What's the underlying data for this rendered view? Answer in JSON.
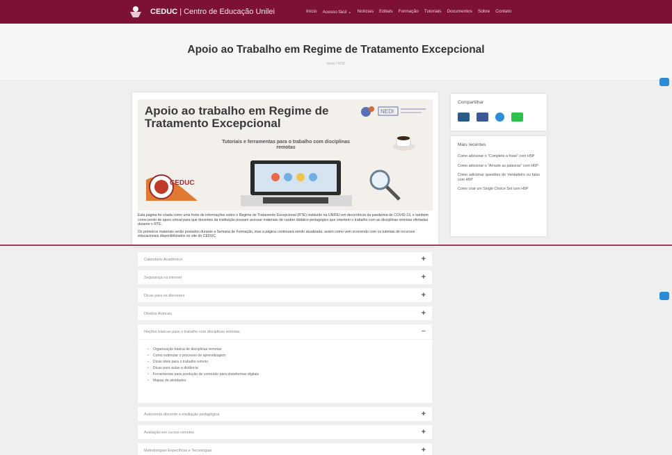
{
  "header": {
    "brand_short": "CEDUC",
    "brand_full": "| Centro de Educação Unilei",
    "nav": [
      {
        "label": "Início"
      },
      {
        "label": "Acesso fácil ⌄"
      },
      {
        "label": "Notícias"
      },
      {
        "label": "Editais"
      },
      {
        "label": "Formação"
      },
      {
        "label": "Tutoriais"
      },
      {
        "label": "Documentos"
      },
      {
        "label": "Sobre"
      },
      {
        "label": "Contato"
      }
    ]
  },
  "page": {
    "title": "Apoio ao Trabalho em Regime de Tratamento Excepcional",
    "breadcrumb": "Início / RTE"
  },
  "banner": {
    "title": "Apoio ao trabalho em Regime de Tratamento Excepcional",
    "subtitle": "Tutoriais e ferramentas para o trabalho com disciplinas remotas",
    "nedi_label": "NEDI",
    "ceduc_label": "CEDUC"
  },
  "intro": {
    "p1": "Esta página foi criada como uma fonte de informações sobre o Regime de Tratamento Excepcional (RTE) instituído na UNIFEI em decorrência da pandemia de COVID-19, e também como ponto de apoio virtual para que docentes da instituição possam acessar materiais de caráter didático-pedagógico que orientem o trabalho com as disciplinas remotas ofertadas durante o RTE.",
    "p2": "Os primeiros materiais serão postados durante a Semana de Formação, mas a página continuará sendo atualizada, assim como vem ocorrendo com os tutoriais de recursos educacionais disponibilizados no site do CEDUC."
  },
  "share": {
    "heading": "Compartilhar",
    "icons": [
      {
        "name": "email-icon",
        "color": "#2c5b8a"
      },
      {
        "name": "facebook-icon",
        "color": "#3b5998"
      },
      {
        "name": "telegram-icon",
        "color": "#2a8fd4"
      },
      {
        "name": "whatsapp-icon",
        "color": "#2ec24a"
      }
    ]
  },
  "recent": {
    "heading": "Mais recentes",
    "items": [
      "Como adicionar o \"Complete a frase\" com H5P",
      "Como adicionar o \"Arraste as palavras\" com H5P",
      "Como adicionar questões de Verdadeiro ou falso com H5P",
      "Como criar um Single Choice Set com H5P"
    ]
  },
  "accordion": {
    "before": [
      {
        "label": "Calendário Acadêmico",
        "sign": "+"
      },
      {
        "label": "Segurança na internet",
        "sign": "+"
      },
      {
        "label": "Dicas para os discentes",
        "sign": "+"
      },
      {
        "label": "Direitos Autorais",
        "sign": "+"
      }
    ],
    "open": {
      "label": "Noções básicas para o trabalho com disciplinas remotas",
      "sign": "−",
      "items": [
        "Organização básica de disciplinas remotas",
        "Como estimular o processo de aprendizagem",
        "Dicas úteis para o trabalho remoto",
        "Dicas para aulas a distância",
        "Ferramentas para produção de conteúdo para plataformas digitais",
        "Mapas de atividades"
      ]
    },
    "after": [
      {
        "label": "Autonomia discente e mediação pedagógica",
        "sign": "+"
      },
      {
        "label": "Avaliação em cursos remotos",
        "sign": "+"
      },
      {
        "label": "Metodologias Específicas e Tecnologias",
        "sign": "+"
      }
    ]
  },
  "colors": {
    "brand": "#7d1133",
    "divider": "#9c3b57",
    "float_button": "#2b8bd6"
  }
}
